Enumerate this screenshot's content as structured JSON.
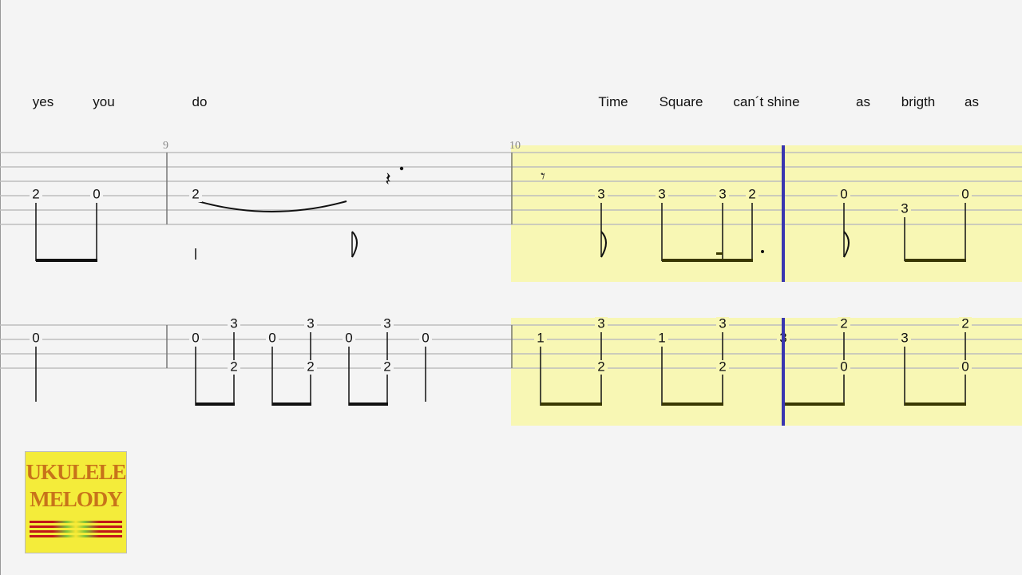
{
  "lyrics": [
    "yes",
    "you",
    "do",
    "Time",
    "Square",
    "can´t shine",
    "as",
    "brigth",
    "as"
  ],
  "measures": [
    "9",
    "10"
  ],
  "top_frets": [
    "2",
    "0",
    "2",
    "3",
    "3",
    "3",
    "2",
    "0",
    "3",
    "0"
  ],
  "bottom_frets": [
    "0",
    "0",
    "3",
    "2",
    "0",
    "3",
    "2",
    "0",
    "3",
    "2",
    "0",
    "1",
    "3",
    "2",
    "1",
    "3",
    "2",
    "3",
    "2",
    "0",
    "3",
    "2",
    "0"
  ],
  "logo": {
    "line1": "UKULELE",
    "line2": "MELODY"
  },
  "colors": {
    "highlight": "#f8f7b4",
    "cursor": "#3a36b0",
    "logo_bg": "#f4ec3a",
    "logo_text": "#c8731a"
  }
}
